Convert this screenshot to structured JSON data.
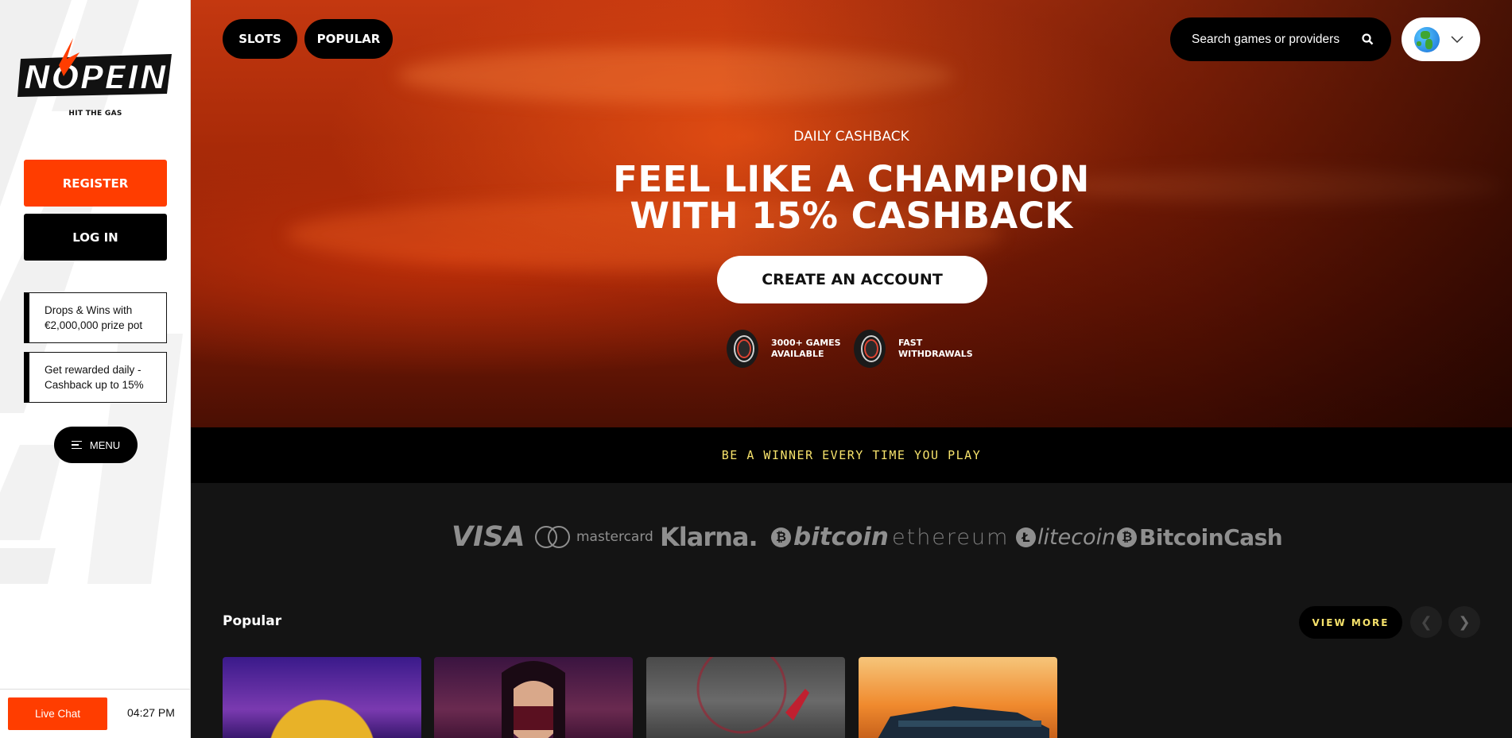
{
  "brand": {
    "logo_text": "NOPEIN",
    "tagline": "HIT THE GAS"
  },
  "sidebar": {
    "register_label": "REGISTER",
    "login_label": "LOG IN",
    "promos": [
      {
        "text": "Drops & Wins with €2,000,000 prize pot"
      },
      {
        "text": "Get rewarded daily - Cashback up to 15%"
      }
    ],
    "menu_label": "MENU",
    "live_chat_label": "Live Chat",
    "time": "04:27 PM"
  },
  "topnav": {
    "pills": [
      {
        "label": "SLOTS"
      },
      {
        "label": "POPULAR"
      }
    ],
    "search_placeholder": "Search games or providers",
    "language_icon": "globe-icon"
  },
  "hero": {
    "eyebrow": "DAILY CASHBACK",
    "title_line1": "FEEL LIKE A CHAMPION",
    "title_line2": "WITH 15% CASHBACK",
    "cta_label": "CREATE AN ACCOUNT",
    "features": [
      {
        "line1": "3000+ GAMES",
        "line2": "AVAILABLE"
      },
      {
        "line1": "FAST",
        "line2": "WITHDRAWALS"
      }
    ]
  },
  "ribbon": {
    "text": "BE A WINNER EVERY TIME YOU PLAY"
  },
  "payments": {
    "visa": "VISA",
    "mastercard": "mastercard",
    "klarna": "Klarna.",
    "bitcoin": "bitcoin",
    "ethereum": "ethereum",
    "litecoin": "litecoin",
    "bitcoincash": "BitcoinCash"
  },
  "popular": {
    "title": "Popular",
    "view_more_label": "VIEW MORE",
    "tiles": [
      "game-tile-1",
      "game-tile-2",
      "game-tile-3",
      "game-tile-4"
    ]
  },
  "colors": {
    "accent": "#ff3d00",
    "ribbon_text": "#f6e26b",
    "main_bg": "#141414"
  }
}
